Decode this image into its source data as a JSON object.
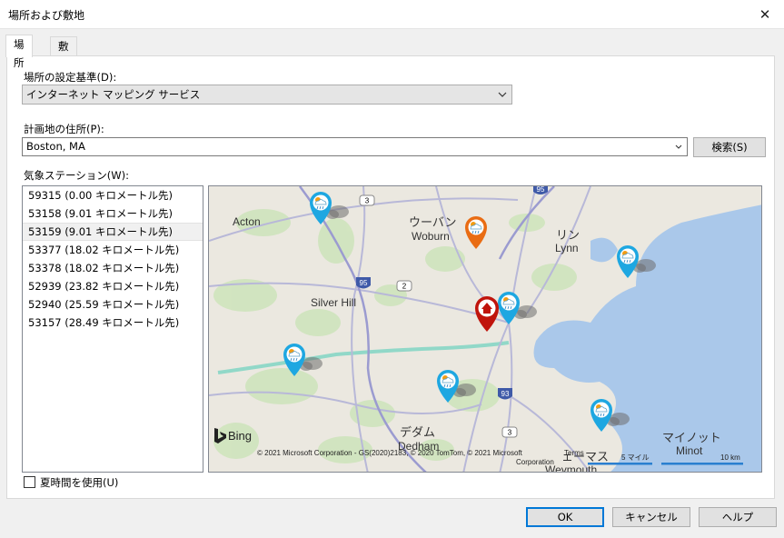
{
  "window": {
    "title": "場所および敷地"
  },
  "tabs": [
    {
      "label": "場所",
      "active": true
    },
    {
      "label": "敷地",
      "active": false
    }
  ],
  "location_basis": {
    "label": "場所の設定基準(D):",
    "selected": "インターネット マッピング サービス"
  },
  "address": {
    "label": "計画地の住所(P):",
    "value": "Boston, MA",
    "search_label": "検索(S)"
  },
  "stations": {
    "label": "気象ステーション(W):",
    "selected_index": 2,
    "items": [
      "59315 (0.00 キロメートル先)",
      "53158 (9.01 キロメートル先)",
      "53159 (9.01 キロメートル先)",
      "53377 (18.02 キロメートル先)",
      "53378 (18.02 キロメートル先)",
      "52939 (23.82 キロメートル先)",
      "52940 (25.59 キロメートル先)",
      "53157 (28.49 キロメートル先)"
    ]
  },
  "map": {
    "places": {
      "acton": "Acton",
      "woburn_ja": "ウーバン",
      "woburn": "Woburn",
      "lynn_ja": "リン",
      "lynn": "Lynn",
      "silver_hill": "Silver Hill",
      "dedham_ja": "デダム",
      "dedham": "Dedham",
      "weymouth_ja": "ェーマス",
      "weymouth": "Weymouth",
      "minot_ja": "マイノット",
      "minot": "Minot"
    },
    "routes": {
      "r3a": "3",
      "r95a": "95",
      "r95b": "95",
      "r2": "2",
      "r93": "93",
      "r3b": "3"
    },
    "bing": "Bing",
    "copyright": "© 2021 Microsoft Corporation - GS(2020)2183, © 2020 TomTom, © 2021 Microsoft",
    "terms": "Terms",
    "corporation": "Corporation",
    "scale_miles": "5 マイル",
    "scale_km": "10 km"
  },
  "dst": {
    "label": "夏時間を使用(U)",
    "checked": false
  },
  "buttons": {
    "ok": "OK",
    "cancel": "キャンセル",
    "help": "ヘルプ"
  },
  "colors": {
    "accent": "#0078d7",
    "station_pin": "#1ea7e1",
    "selected_pin": "#e96c13",
    "site_pin": "#c0140c",
    "water": "#aac8ea"
  }
}
